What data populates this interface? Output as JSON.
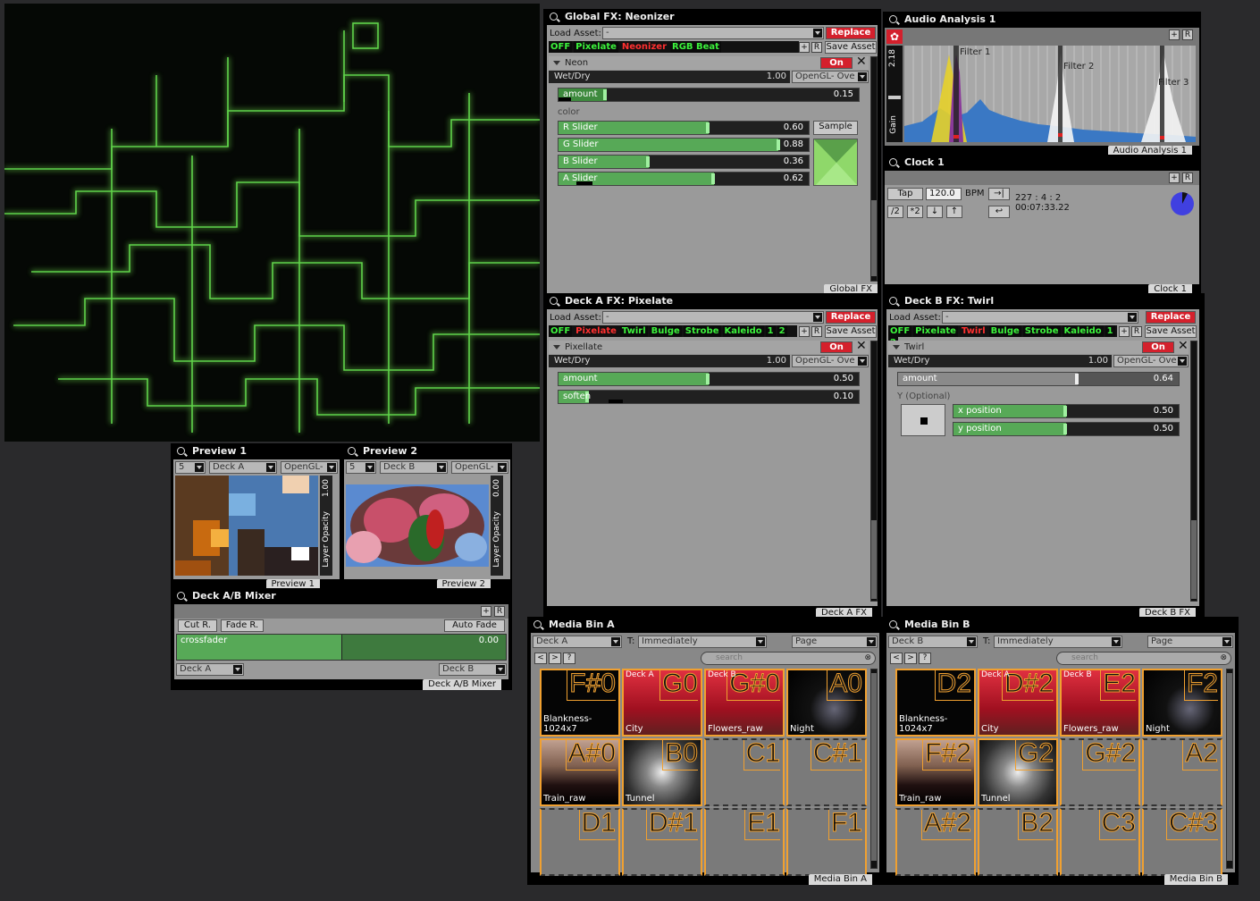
{
  "output": {
    "note": ""
  },
  "global_fx": {
    "title": "Global FX: Neonizer",
    "load_asset_label": "Load Asset:",
    "asset_value": "-",
    "replace": "Replace",
    "chips": [
      "OFF",
      "Pixelate",
      "Neonizer",
      "RGB Beat"
    ],
    "plus": "+",
    "r": "R",
    "save_asset": "Save Asset",
    "section": "Neon",
    "on": "On",
    "wetdry": "Wet/Dry",
    "wetdry_val": "1.00",
    "blend": "OpenGL- Ove",
    "amount": "amount",
    "amount_val": "0.15",
    "color": "color",
    "sliders": [
      {
        "label": "R Slider",
        "val": "0.60"
      },
      {
        "label": "G Slider",
        "val": "0.88"
      },
      {
        "label": "B Slider",
        "val": "0.36"
      },
      {
        "label": "A Slider",
        "val": "0.62"
      }
    ],
    "sample": "Sample",
    "tag": "Global FX"
  },
  "audio": {
    "title": "Audio Analysis 1",
    "gain_val": "2.18",
    "gain": "Gain",
    "filters": [
      "Filter 1",
      "Filter 2",
      "Filter 3"
    ],
    "tag": "Audio Analysis 1"
  },
  "clock": {
    "title": "Clock 1",
    "tap": "Tap",
    "bpm_val": "120.0",
    "bpm": "BPM",
    "pos": "227 : 4 : 2",
    "time": "00:07:33.22",
    "half": "/2",
    "double": "*2",
    "down": "↓",
    "up": "↑",
    "tag": "Clock 1"
  },
  "deck_a_fx": {
    "title": "Deck A FX: Pixelate",
    "load_asset_label": "Load Asset:",
    "asset_value": "-",
    "replace": "Replace",
    "chips": [
      "OFF",
      "Pixelate",
      "Twirl",
      "Bulge",
      "Strobe",
      "Kaleido",
      "1",
      "2"
    ],
    "save_asset": "Save Asset",
    "section": "Pixellate",
    "on": "On",
    "wetdry": "Wet/Dry",
    "wetdry_val": "1.00",
    "blend": "OpenGL- Ove",
    "amount": "amount",
    "amount_val": "0.50",
    "soften": "soften",
    "soften_val": "0.10",
    "tag": "Deck A FX"
  },
  "deck_b_fx": {
    "title": "Deck B FX: Twirl",
    "load_asset_label": "Load Asset:",
    "asset_value": "-",
    "replace": "Replace",
    "chips": [
      "OFF",
      "Pixelate",
      "Twirl",
      "Bulge",
      "Strobe",
      "Kaleido",
      "1",
      "2"
    ],
    "save_asset": "Save Asset",
    "section": "Twirl",
    "on": "On",
    "wetdry": "Wet/Dry",
    "wetdry_val": "1.00",
    "blend": "OpenGL- Ove",
    "amount": "amount",
    "amount_val": "0.64",
    "y_optional": "Y (Optional)",
    "xpos": "x position",
    "xpos_val": "0.50",
    "ypos": "y position",
    "ypos_val": "0.50",
    "tag": "Deck B FX"
  },
  "preview1": {
    "title": "Preview 1",
    "num": "5",
    "deck": "Deck A",
    "blend": "OpenGL-",
    "opacity_val": "1.00",
    "opacity": "Layer Opacity",
    "tag": "Preview 1"
  },
  "preview2": {
    "title": "Preview 2",
    "num": "5",
    "deck": "Deck B",
    "blend": "OpenGL-",
    "opacity_val": "0.00",
    "opacity": "Layer Opacity",
    "tag": "Preview 2"
  },
  "mixer": {
    "title": "Deck A/B Mixer",
    "cut": "Cut R.",
    "fade": "Fade R.",
    "auto": "Auto Fade",
    "crossfader": "crossfader",
    "cf_val": "0.00",
    "deck_a": "Deck A",
    "deck_b": "Deck B",
    "tag": "Deck A/B Mixer"
  },
  "bin_a": {
    "title": "Media Bin A",
    "deck": "Deck A",
    "t": "T:",
    "when": "Immediately",
    "page": "Page",
    "search": "search",
    "q": "?",
    "tag": "Media Bin A",
    "cells": [
      {
        "n": "F#0",
        "name": "Blankness-1024x7",
        "deck": "",
        "img": "black"
      },
      {
        "n": "G0",
        "name": "City",
        "deck": "Deck A",
        "img": "red"
      },
      {
        "n": "G#0",
        "name": "Flowers_raw",
        "deck": "Deck B",
        "img": "red"
      },
      {
        "n": "A0",
        "name": "Night",
        "deck": "",
        "img": "night"
      },
      {
        "n": "A#0",
        "name": "Train_raw",
        "deck": "",
        "img": "train"
      },
      {
        "n": "B0",
        "name": "Tunnel",
        "deck": "",
        "img": "tunnel"
      },
      {
        "n": "C1",
        "name": "",
        "deck": "",
        "img": "empty"
      },
      {
        "n": "C#1",
        "name": "",
        "deck": "",
        "img": "empty"
      },
      {
        "n": "D1",
        "name": "",
        "deck": "",
        "img": "empty"
      },
      {
        "n": "D#1",
        "name": "",
        "deck": "",
        "img": "empty"
      },
      {
        "n": "E1",
        "name": "",
        "deck": "",
        "img": "empty"
      },
      {
        "n": "F1",
        "name": "",
        "deck": "",
        "img": "empty"
      }
    ]
  },
  "bin_b": {
    "title": "Media Bin B",
    "deck": "Deck B",
    "t": "T:",
    "when": "Immediately",
    "page": "Page",
    "search": "search",
    "q": "?",
    "tag": "Media Bin B",
    "cells": [
      {
        "n": "D2",
        "name": "Blankness-1024x7",
        "deck": "",
        "img": "black"
      },
      {
        "n": "D#2",
        "name": "City",
        "deck": "Deck A",
        "img": "red"
      },
      {
        "n": "E2",
        "name": "Flowers_raw",
        "deck": "Deck B",
        "img": "red"
      },
      {
        "n": "F2",
        "name": "Night",
        "deck": "",
        "img": "night"
      },
      {
        "n": "F#2",
        "name": "Train_raw",
        "deck": "",
        "img": "train"
      },
      {
        "n": "G2",
        "name": "Tunnel",
        "deck": "",
        "img": "tunnel"
      },
      {
        "n": "G#2",
        "name": "",
        "deck": "",
        "img": "empty"
      },
      {
        "n": "A2",
        "name": "",
        "deck": "",
        "img": "empty"
      },
      {
        "n": "A#2",
        "name": "",
        "deck": "",
        "img": "empty"
      },
      {
        "n": "B2",
        "name": "",
        "deck": "",
        "img": "empty"
      },
      {
        "n": "C3",
        "name": "",
        "deck": "",
        "img": "empty"
      },
      {
        "n": "C#3",
        "name": "",
        "deck": "",
        "img": "empty"
      }
    ]
  }
}
